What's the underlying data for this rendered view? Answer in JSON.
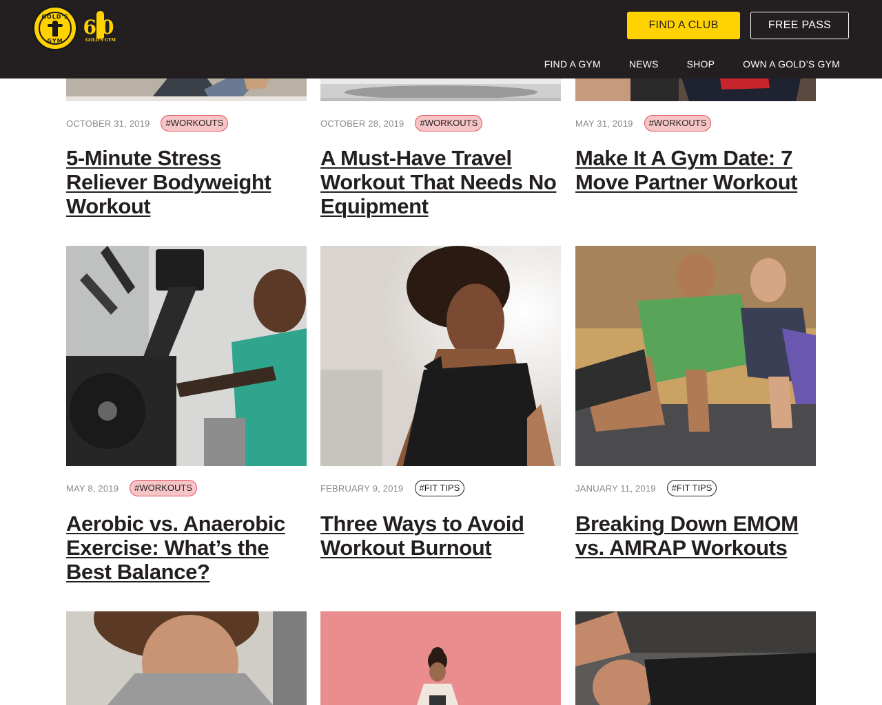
{
  "header": {
    "logo_seal_text_top": "GOLD'S",
    "logo_seal_text_bottom": "GYM",
    "anniversary_number": "60",
    "anniversary_sub": "GOLD'S GYM",
    "find_club_label": "FIND A CLUB",
    "free_pass_label": "FREE PASS",
    "nav": [
      "FIND A GYM",
      "NEWS",
      "SHOP",
      "OWN A GOLD’S GYM"
    ]
  },
  "colors": {
    "header_bg": "#231f20",
    "brand_yellow": "#ffd200",
    "workouts_tag_bg": "#f7c5c7",
    "workouts_tag_border": "#e0525b"
  },
  "articles": [
    {
      "date": "OCTOBER 31, 2019",
      "tag": "#WORKOUTS",
      "title": "5-Minute Stress Reliever Bodyweight Workout"
    },
    {
      "date": "OCTOBER 28, 2019",
      "tag": "#WORKOUTS",
      "title": "A Must-Have Travel Workout That Needs No Equipment"
    },
    {
      "date": "MAY 31, 2019",
      "tag": "#WORKOUTS",
      "title": "Make It A Gym Date: 7 Move Partner Workout"
    },
    {
      "date": "MAY 8, 2019",
      "tag": "#WORKOUTS",
      "title": "Aerobic vs. Anaerobic Exercise: What’s the Best Balance?"
    },
    {
      "date": "FEBRUARY 9, 2019",
      "tag": "#FIT TIPS",
      "title": "Three Ways to Avoid Workout Burnout"
    },
    {
      "date": "JANUARY 11, 2019",
      "tag": "#FIT TIPS",
      "title": "Breaking Down EMOM vs. AMRAP Workouts"
    }
  ]
}
